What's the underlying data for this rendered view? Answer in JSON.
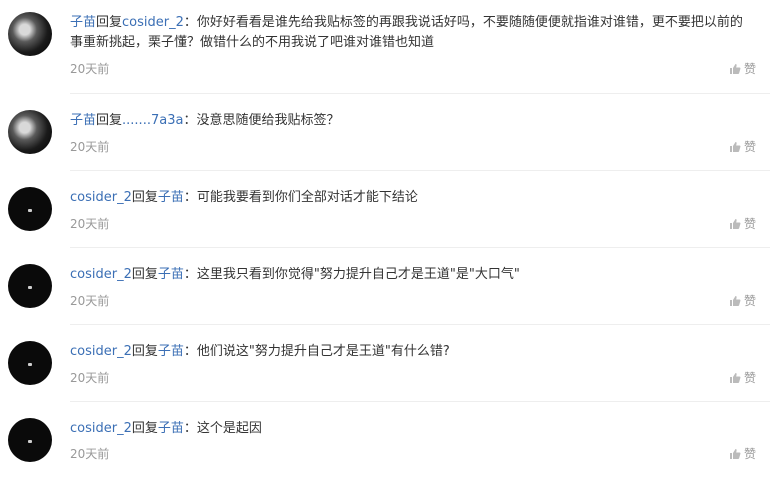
{
  "comments": [
    {
      "avatar": "sketch-face-avatar",
      "author": "子苗",
      "reply_word": "回复",
      "reply_to": "cosider_2",
      "text": "：你好好看看是谁先给我贴标签的再跟我说话好吗，不要随随便便就指谁对谁错，更不要把以前的事重新挑起，栗子懂？做错什么的不用我说了吧谁对谁错也知道",
      "time": "20天前",
      "like_label": "赞"
    },
    {
      "avatar": "sketch-face-avatar",
      "author": "子苗",
      "reply_word": "回复",
      "reply_to": ".......7a3a",
      "text": "：没意思随便给我贴标签？",
      "time": "20天前",
      "like_label": "赞"
    },
    {
      "avatar": "black-avatar",
      "author": "cosider_2",
      "reply_word": "回复",
      "reply_to": "子苗",
      "text": "：可能我要看到你们全部对话才能下结论",
      "time": "20天前",
      "like_label": "赞"
    },
    {
      "avatar": "black-avatar",
      "author": "cosider_2",
      "reply_word": "回复",
      "reply_to": "子苗",
      "text": "：这里我只看到你觉得\"努力提升自己才是王道\"是\"大口气\"",
      "time": "20天前",
      "like_label": "赞"
    },
    {
      "avatar": "black-avatar",
      "author": "cosider_2",
      "reply_word": "回复",
      "reply_to": "子苗",
      "text": "：他们说这\"努力提升自己才是王道\"有什么错?",
      "time": "20天前",
      "like_label": "赞"
    },
    {
      "avatar": "black-avatar",
      "author": "cosider_2",
      "reply_word": "回复",
      "reply_to": "子苗",
      "text": "：这个是起因",
      "time": "20天前",
      "like_label": "赞"
    }
  ]
}
